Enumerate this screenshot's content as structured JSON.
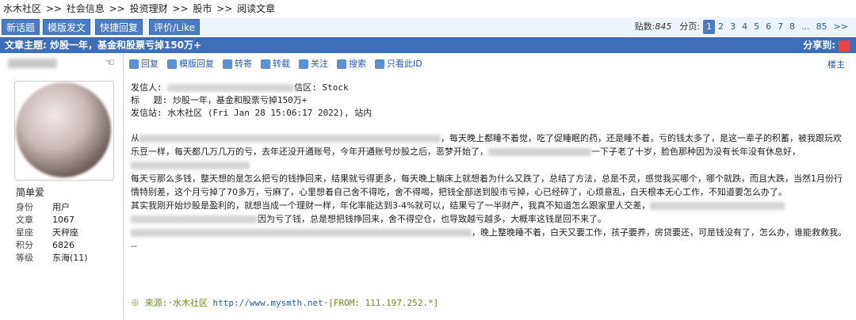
{
  "breadcrumb": [
    "水木社区",
    ">>",
    "社会信息",
    ">>",
    "投资理财",
    ">>",
    "股市",
    ">>",
    "阅读文章"
  ],
  "toolbar": {
    "new_topic": "新话题",
    "template_post": "模版发文",
    "quick_reply": "快捷回复",
    "rate_like": "评价/Like"
  },
  "pager": {
    "posts_label": "贴数:",
    "posts_count": "845",
    "pages_label": "分页:",
    "pages": [
      "1",
      "2",
      "3",
      "4",
      "5",
      "6",
      "7",
      "8",
      "...",
      "85",
      ">>"
    ]
  },
  "subject_bar": {
    "text": "文章主题: 炒股一年，基金和股票亏掉150万+",
    "share_label": "分享到:"
  },
  "user": {
    "signature_name": "简单爱",
    "stats": [
      {
        "k": "身份",
        "v": "用户"
      },
      {
        "k": "文章",
        "v": "1067"
      },
      {
        "k": "星座",
        "v": "天秤座"
      },
      {
        "k": "积分",
        "v": "6826"
      },
      {
        "k": "等级",
        "v": "东海(11)"
      }
    ]
  },
  "actions": [
    "回复",
    "模版回复",
    "转寄",
    "转载",
    "关注",
    "搜索",
    "只看此ID"
  ],
  "floor_label": "楼主",
  "header": {
    "from_label": "发信人:",
    "board_tail": "信区: Stock",
    "title_line": "标　 题: 炒股一年，基金和股票亏掉150万+",
    "site_line": "发信站: 水木社区 (Fri Jan 28 15:06:17 2022), 站内"
  },
  "body": {
    "p1_a": "从",
    "p1_b": "，每天晚上都睡不着觉，吃了促睡眠的药，还是睡不着，亏的钱太多了，是这一辈子的积蓄，被我跟玩欢乐豆一样，每天都几万几万的亏，去年还没开通账号，今年开通账号炒股之后，恶梦开始了，",
    "p1_c": "一下子老了十岁，脸色那种因为没有长年没有休息好，",
    "p2": "每天亏那么多钱，整天想的是怎么把亏的钱挣回来，结果就亏得更多，每天晚上躺床上就想着为什么又跌了，总结了方法，总是不灵，感觉我买哪个，哪个就跌，而且大跌，当然1月份行情特别差，这个月亏掉了70多万，亏麻了，心里想着自己舍不得吃，舍不得喝，把钱全部送到股市亏掉，心已经碎了，心烦意乱，白天根本无心工作，不知道要怎么办了。",
    "p3_a": "其实我刚开始炒股是盈利的，就想当成一个理财一样，年化率能达到3-4%就可以，结果亏了一半财产，我真不知道怎么跟家里人交差，",
    "p3_b": "因为亏了钱，总是想把钱挣回来，舍不得空仓，也导致越亏越多，大概率这钱是回不来了。",
    "p4_b": "，晚上整晚睡不着，白天又要工作，孩子要养，房贷要还，可是钱没有了，怎么办，谁能救救我。",
    "dashes": "--"
  },
  "source": {
    "prefix": "※ 来源:·水木社区 ",
    "url": "http://www.mysmth.net",
    "suffix": "·[FROM: 111.197.252.*]"
  }
}
